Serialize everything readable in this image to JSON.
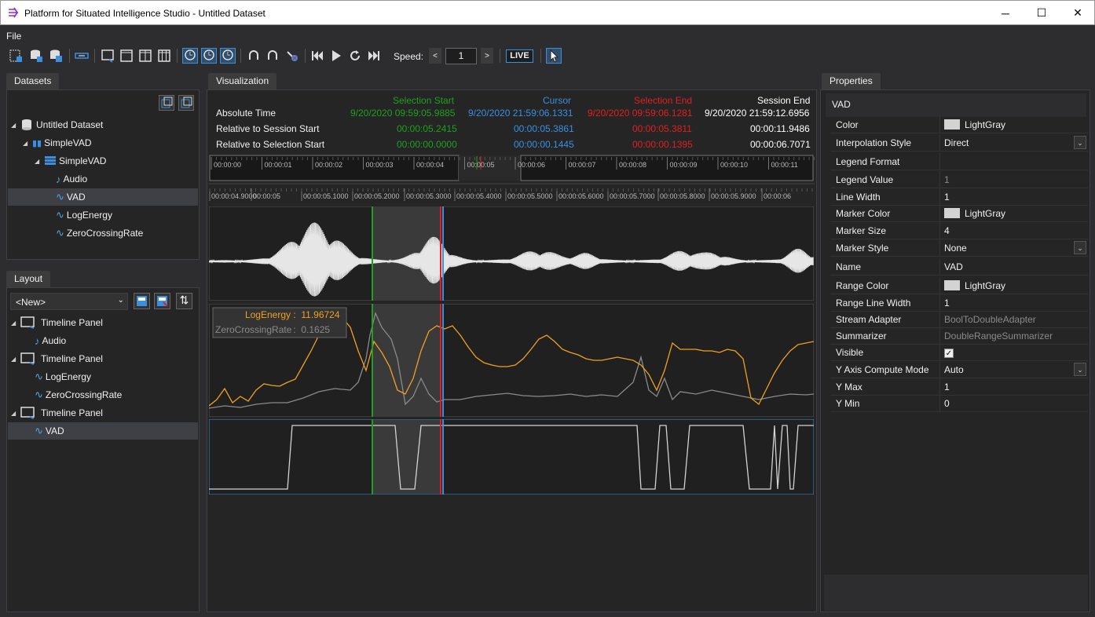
{
  "window": {
    "title": "Platform for Situated Intelligence Studio - Untitled Dataset",
    "minimize": "─",
    "maximize": "☐",
    "close": "✕"
  },
  "menu": {
    "file": "File"
  },
  "toolbar": {
    "speed_label": "Speed:",
    "speed_value": "1",
    "live_label": "LIVE"
  },
  "datasets": {
    "tab": "Datasets",
    "items": [
      {
        "label": "Untitled Dataset"
      },
      {
        "label": "SimpleVAD"
      },
      {
        "label": "SimpleVAD"
      },
      {
        "label": "Audio"
      },
      {
        "label": "VAD"
      },
      {
        "label": "LogEnergy"
      },
      {
        "label": "ZeroCrossingRate"
      }
    ]
  },
  "layout": {
    "tab": "Layout",
    "selected": "<New>",
    "items": [
      {
        "label": "Timeline Panel"
      },
      {
        "label": "Audio"
      },
      {
        "label": "Timeline Panel"
      },
      {
        "label": "LogEnergy"
      },
      {
        "label": "ZeroCrossingRate"
      },
      {
        "label": "Timeline Panel"
      },
      {
        "label": "VAD"
      }
    ]
  },
  "visualization": {
    "tab": "Visualization",
    "columns": {
      "selection_start": "Selection Start",
      "cursor": "Cursor",
      "selection_end": "Selection End",
      "session_end": "Session End"
    },
    "rows": [
      {
        "label": "Absolute Time",
        "selection_start": "9/20/2020 09:59:05.9885",
        "cursor": "9/20/2020 21:59:06.1331",
        "selection_end": "9/20/2020 09:59:06.1281",
        "session_end": "9/20/2020 21:59:12.6956"
      },
      {
        "label": "Relative to Session Start",
        "selection_start": "00:00:05.2415",
        "cursor": "00:00:05.3861",
        "selection_end": "00:00:05.3811",
        "session_end": "00:00:11.9486"
      },
      {
        "label": "Relative to Selection Start",
        "selection_start": "00:00:00.0000",
        "cursor": "00:00:00.1445",
        "selection_end": "00:00:00.1395",
        "session_end": "00:00:06.7071"
      }
    ],
    "colors": {
      "selection_start": "#1fa01f",
      "cursor": "#3b8fe0",
      "selection_end": "#e02020",
      "session_end": "#ffffff",
      "log_energy": "#f0a020",
      "zcr": "#9a9a9a"
    },
    "nav_ticks": [
      "00:00:00",
      "00:00:01",
      "00:00:02",
      "00:00:03",
      "00:00:04",
      "00:00:05",
      "00:00:06",
      "00:00:07",
      "00:00:08",
      "00:00:09",
      "00:00:10",
      "00:00:11"
    ],
    "zoom_ticks": [
      "00:00:04.9000",
      "00:00:05",
      "00:00:05.1000",
      "00:00:05.2000",
      "00:00:05.3000",
      "00:00:05.4000",
      "00:00:05.5000",
      "00:00:05.6000",
      "00:00:05.7000",
      "00:00:05.8000",
      "00:00:05.9000",
      "00:00:06"
    ],
    "legend": [
      {
        "name": "LogEnergy",
        "sep": ":",
        "value": "11.96724"
      },
      {
        "name": "ZeroCrossingRate",
        "sep": ":",
        "value": "0.1625"
      }
    ]
  },
  "properties": {
    "tab": "Properties",
    "title": "VAD",
    "rows": [
      {
        "name": "Color",
        "value": "LightGray",
        "swatch": true
      },
      {
        "name": "Interpolation Style",
        "value": "Direct",
        "dropdown": true
      },
      {
        "name": "Legend Format",
        "value": ""
      },
      {
        "name": "Legend Value",
        "value": "1",
        "dim": true
      },
      {
        "name": "Line Width",
        "value": "1"
      },
      {
        "name": "Marker Color",
        "value": "LightGray",
        "swatch": true
      },
      {
        "name": "Marker Size",
        "value": "4"
      },
      {
        "name": "Marker Style",
        "value": "None",
        "dropdown": true
      },
      {
        "name": "Name",
        "value": "VAD"
      },
      {
        "name": "Range Color",
        "value": "LightGray",
        "swatch": true
      },
      {
        "name": "Range Line Width",
        "value": "1"
      },
      {
        "name": "Stream Adapter",
        "value": "BoolToDoubleAdapter",
        "dim": true
      },
      {
        "name": "Summarizer",
        "value": "DoubleRangeSummarizer",
        "dim": true
      },
      {
        "name": "Visible",
        "value": "✓",
        "checkbox": true
      },
      {
        "name": "Y Axis Compute Mode",
        "value": "Auto",
        "dropdown": true
      },
      {
        "name": "Y Max",
        "value": "1"
      },
      {
        "name": "Y Min",
        "value": "0"
      }
    ]
  }
}
